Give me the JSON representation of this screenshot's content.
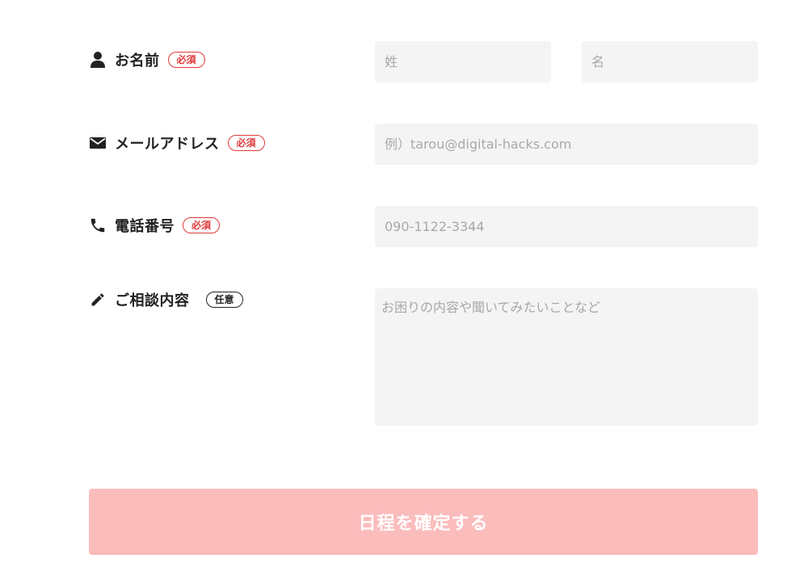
{
  "form": {
    "name": {
      "label": "お名前",
      "icon": "person-icon",
      "badge": "必須",
      "last_placeholder": "姓",
      "first_placeholder": "名"
    },
    "email": {
      "label": "メールアドレス",
      "icon": "envelope-icon",
      "badge": "必須",
      "placeholder": "例）tarou@digital-hacks.com"
    },
    "phone": {
      "label": "電話番号",
      "icon": "phone-icon",
      "badge": "必須",
      "placeholder": "090-1122-3344"
    },
    "consultation": {
      "label": "ご相談内容",
      "icon": "pencil-icon",
      "badge": "任意",
      "placeholder": "お困りの内容や聞いてみたいことなど"
    },
    "submit_label": "日程を確定する"
  },
  "colors": {
    "required": "#e03a3a",
    "field_background": "#f4f4f4",
    "submit_background": "#fbbcbc",
    "label_text": "#222222"
  }
}
